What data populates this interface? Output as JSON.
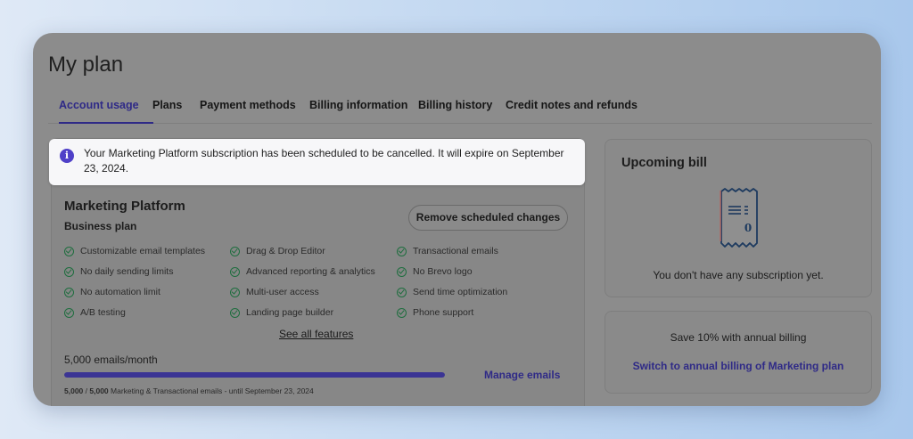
{
  "page": {
    "title": "My plan"
  },
  "tabs": [
    {
      "label": "Account usage",
      "active": true
    },
    {
      "label": "Plans"
    },
    {
      "label": "Payment methods"
    },
    {
      "label": "Billing information"
    },
    {
      "label": "Billing history"
    },
    {
      "label": "Credit notes and refunds"
    }
  ],
  "banner": {
    "icon": "info-icon",
    "text": "Your Marketing Platform subscription has been scheduled to be cancelled. It will expire on September 23, 2024."
  },
  "plan": {
    "name": "Marketing Platform",
    "tier": "Business plan",
    "remove_button": "Remove scheduled changes",
    "features": [
      [
        "Customizable email templates",
        "No daily sending limits",
        "No automation limit",
        "A/B testing"
      ],
      [
        "Drag & Drop Editor",
        "Advanced reporting & analytics",
        "Multi-user access",
        "Landing page builder"
      ],
      [
        "Transactional emails",
        "No Brevo logo",
        "Send time optimization",
        "Phone support"
      ]
    ],
    "see_all": "See all features",
    "emails_per_month": "5,000 emails/month",
    "usage_fraction": 1.0,
    "manage_emails": "Manage emails",
    "usage_used": "5,000",
    "usage_separator": " / ",
    "usage_total": "5,000",
    "usage_note": " Marketing & Transactional emails - until September 23, 2024"
  },
  "upcoming_bill": {
    "title": "Upcoming bill",
    "icon": "receipt-icon",
    "receipt_amount": "0",
    "message": "You don't have any subscription yet."
  },
  "annual": {
    "text": "Save 10% with annual billing",
    "link": "Switch to annual billing of Marketing plan"
  },
  "colors": {
    "accent": "#2f2a87",
    "info": "#4f40c8",
    "check": "#1f6e3f",
    "overlay": "#8c8c8c"
  }
}
